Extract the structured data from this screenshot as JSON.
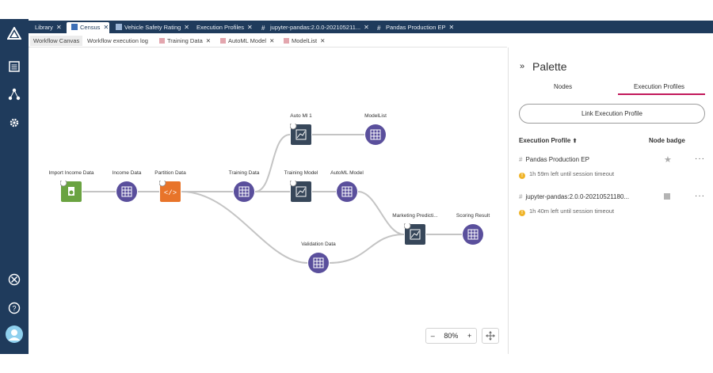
{
  "top_tabs": [
    {
      "label": "Library",
      "active": false
    },
    {
      "label": "Census",
      "active": true
    },
    {
      "label": "Vehicle Safety Rating",
      "active": false
    },
    {
      "label": "Execution Profiles",
      "active": false
    },
    {
      "label": "jupyter-pandas:2.0.0-202105211...",
      "active": false
    },
    {
      "label": "Pandas Production EP",
      "active": false
    }
  ],
  "sub_tabs": [
    {
      "label": "Workflow Canvas",
      "active": true
    },
    {
      "label": "Workflow execution log",
      "active": false
    },
    {
      "label": "Training Data",
      "active": false
    },
    {
      "label": "AutoML Model",
      "active": false
    },
    {
      "label": "ModelList",
      "active": false
    }
  ],
  "nodes": {
    "import_income": "Import Income Data",
    "income": "Income Data",
    "partition": "Partition Data",
    "training": "Training Data",
    "automl1": "Auto Ml 1",
    "modellist": "ModelList",
    "training_model": "Training Model",
    "automl_model": "AutoML Model",
    "validation": "Validation Data",
    "marketing": "Marketing Predicti...",
    "scoring": "Scoring Result"
  },
  "zoom": {
    "minus": "–",
    "value": "80%",
    "plus": "+"
  },
  "palette": {
    "title": "Palette",
    "tabs": {
      "nodes": "Nodes",
      "execution_profiles": "Execution Profiles"
    },
    "link_button": "Link Execution Profile",
    "headers": {
      "profile": "Execution Profile",
      "badge": "Node badge"
    },
    "profiles": [
      {
        "name": "Pandas Production EP",
        "status": "1h 59m left until session timeout"
      },
      {
        "name": "jupyter-pandas:2.0.0-20210521180...",
        "status": "1h 40m left until session timeout"
      }
    ],
    "more": "···"
  },
  "colors": {
    "nav": "#1f3b5c",
    "accent": "#c2185b",
    "node_purple": "#5a4f9c",
    "node_green": "#6aa341",
    "node_orange": "#e8742a",
    "node_slate": "#37475a"
  }
}
